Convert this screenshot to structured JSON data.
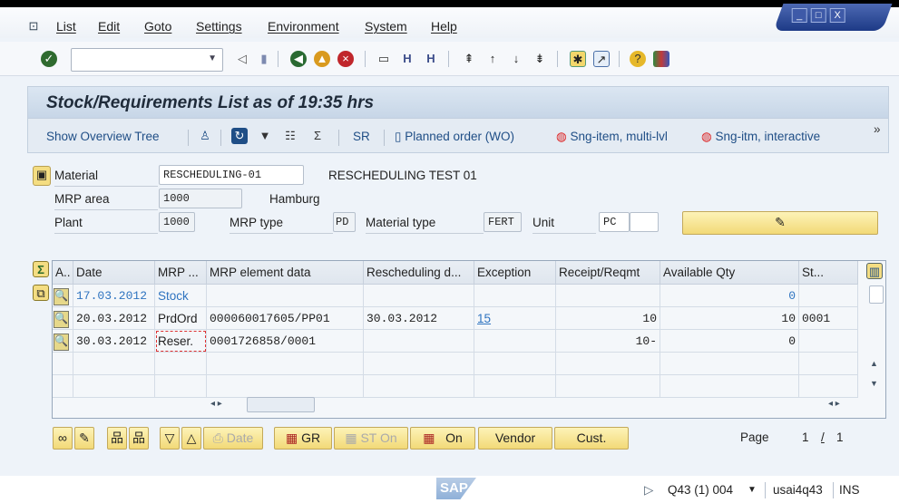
{
  "menu": [
    "List",
    "Edit",
    "Goto",
    "Settings",
    "Environment",
    "System",
    "Help"
  ],
  "command_field": {
    "value": ""
  },
  "title": "Stock/Requirements List as of 19:35 hrs",
  "app_toolbar": {
    "show_overview_tree": "Show Overview Tree",
    "sr": "SR",
    "planned_order": "Planned order (WO)",
    "sng_item_multi": "Sng-item, multi-lvl",
    "sng_item_interactive": "Sng-itm, interactive",
    "more": "»"
  },
  "header": {
    "material_label": "Material",
    "material_value": "RESCHEDULING-01",
    "material_desc": "RESCHEDULING TEST 01",
    "mrp_area_label": "MRP area",
    "mrp_area_value": "1000",
    "mrp_area_desc": "Hamburg",
    "plant_label": "Plant",
    "plant_value": "1000",
    "mrp_type_label": "MRP type",
    "mrp_type_value": "PD",
    "material_type_label": "Material type",
    "material_type_value": "FERT",
    "unit_label": "Unit",
    "unit_value": "PC"
  },
  "table": {
    "columns": [
      "A..",
      "Date",
      "MRP ...",
      "MRP element data",
      "Rescheduling d...",
      "Exception",
      "Receipt/Reqmt",
      "Available Qty",
      "St..."
    ],
    "rows": [
      {
        "date": "17.03.2012",
        "mrp": "Stock",
        "data": "",
        "resched": "",
        "exception": "",
        "receipt": "",
        "available": "0",
        "st": ""
      },
      {
        "date": "20.03.2012",
        "mrp": "PrdOrd",
        "data": "000060017605/PP01",
        "resched": "30.03.2012",
        "exception": "15",
        "receipt": "10",
        "available": "10",
        "st": "0001"
      },
      {
        "date": "30.03.2012",
        "mrp": "Reser.",
        "data": "0001726858/0001",
        "resched": "",
        "exception": "",
        "receipt": "10-",
        "available": "0",
        "st": ""
      }
    ]
  },
  "buttons": {
    "date": "Date",
    "gr": "GR",
    "st_on": "ST On",
    "on": "On",
    "vendor": "Vendor",
    "cust": "Cust."
  },
  "page": {
    "label": "Page",
    "current": "1",
    "sep": "/",
    "total": "1"
  },
  "status": {
    "system": "Q43 (1) 004",
    "server": "usai4q43",
    "mode": "INS",
    "logo": "SAP"
  }
}
